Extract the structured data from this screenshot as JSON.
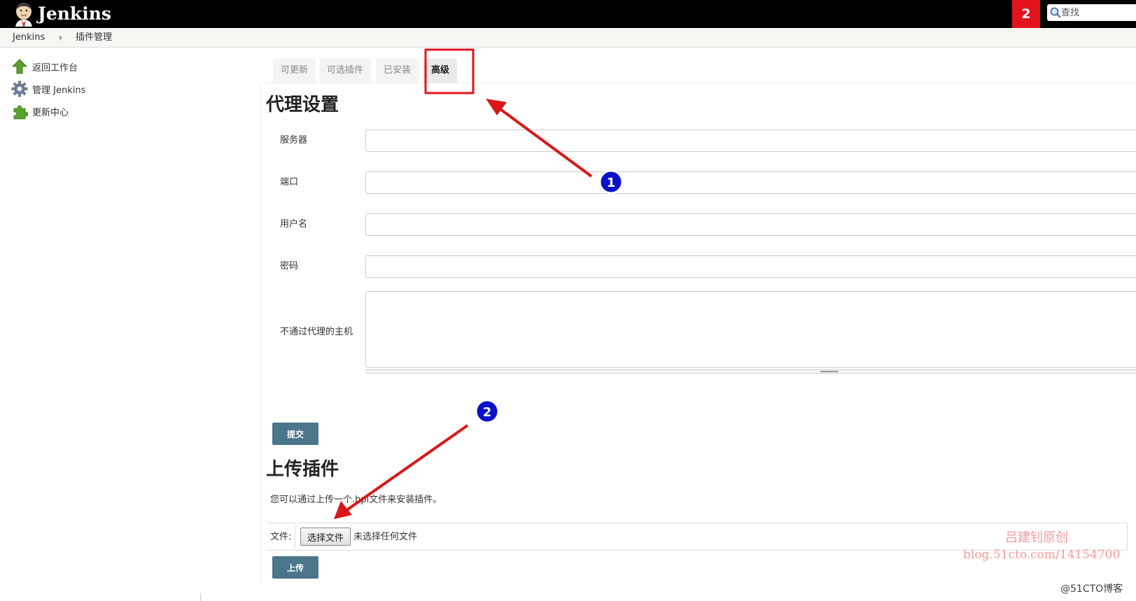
{
  "header": {
    "app_name": "Jenkins",
    "notification_count": "2",
    "search_placeholder": "查找"
  },
  "breadcrumb": [
    "Jenkins",
    "插件管理"
  ],
  "sidebar": {
    "items": [
      {
        "label": "返回工作台",
        "icon": "up-arrow-icon"
      },
      {
        "label": "管理 Jenkins",
        "icon": "gear-icon"
      },
      {
        "label": "更新中心",
        "icon": "puzzle-icon"
      }
    ]
  },
  "tabs": [
    {
      "label": "可更新",
      "active": false
    },
    {
      "label": "可选插件",
      "active": false
    },
    {
      "label": "已安装",
      "active": false
    },
    {
      "label": "高级",
      "active": true
    }
  ],
  "proxy": {
    "title": "代理设置",
    "fields": [
      {
        "label": "服务器",
        "value": ""
      },
      {
        "label": "端口",
        "value": ""
      },
      {
        "label": "用户名",
        "value": ""
      },
      {
        "label": "密码",
        "value": ""
      },
      {
        "label": "不通过代理的主机",
        "value": ""
      }
    ],
    "submit_label": "提交"
  },
  "upload": {
    "title": "上传插件",
    "description": "您可以通过上传一个.hpi文件来安装插件。",
    "file_label": "文件:",
    "choose_label": "选择文件",
    "no_file_text": "未选择任何文件",
    "upload_label": "上传"
  },
  "annotations": {
    "markers": [
      "1",
      "2"
    ],
    "highlight_color": "#e3131e",
    "marker_color": "#0a12c8"
  },
  "watermark": {
    "author": "吕建钊原创",
    "url": "blog.51cto.com/14154700",
    "site": "@51CTO博客"
  },
  "colors": {
    "header_bg": "#000000",
    "button_bg": "#4b758b",
    "notification_bg": "#e3131e"
  }
}
